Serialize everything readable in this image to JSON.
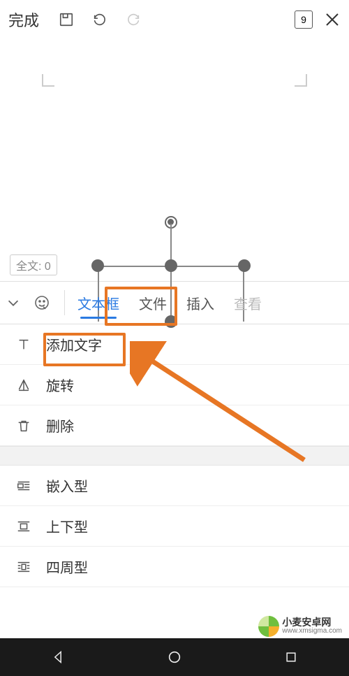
{
  "topbar": {
    "done": "完成",
    "page_count": "9"
  },
  "canvas": {
    "word_count_prefix": "全文: ",
    "word_count": "0"
  },
  "tabs": {
    "active": "文本框",
    "file": "文件",
    "insert": "插入",
    "view": "查看"
  },
  "menu": {
    "add_text": "添加文字",
    "rotate": "旋转",
    "delete": "删除",
    "wrap_inline": "嵌入型",
    "wrap_topbottom": "上下型",
    "wrap_around": "四周型"
  },
  "watermark": {
    "name": "小麦安卓网",
    "url": "www.xmsigma.com"
  }
}
